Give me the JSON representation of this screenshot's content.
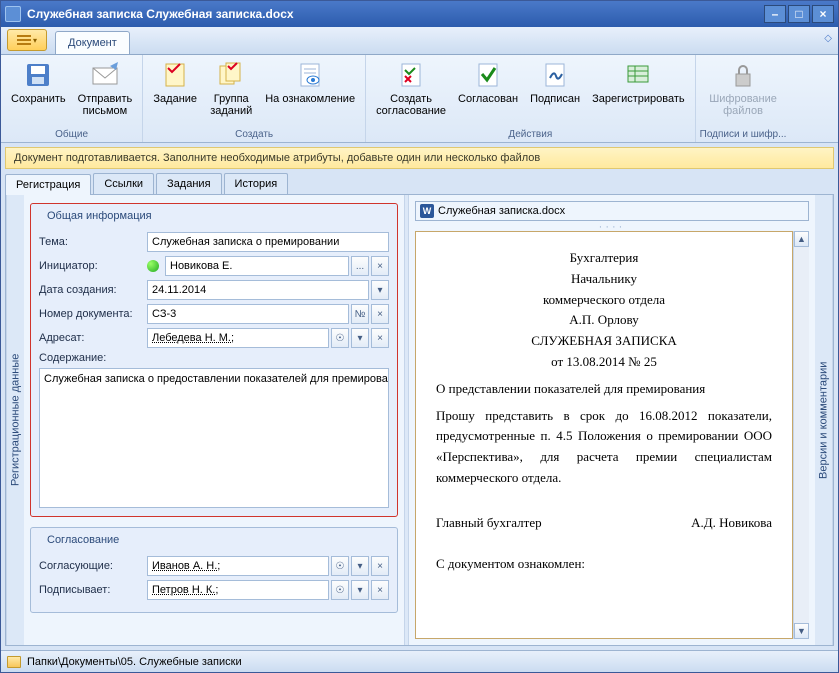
{
  "window": {
    "title": "Служебная записка Служебная записка.docx"
  },
  "menu": {
    "tab_document": "Документ"
  },
  "ribbon": {
    "save": "Сохранить",
    "send_letter": "Отправить\nписьмом",
    "task": "Задание",
    "task_group": "Группа\nзаданий",
    "review": "На ознакомление",
    "create_approval": "Создать\nсогласование",
    "approved": "Согласован",
    "signed": "Подписан",
    "register": "Зарегистрировать",
    "encrypt": "Шифрование\nфайлов",
    "g_common": "Общие",
    "g_create": "Создать",
    "g_actions": "Действия",
    "g_sign": "Подписи и шифр..."
  },
  "infobar": "Документ подготавливается. Заполните необходимые атрибуты, добавьте один или несколько файлов",
  "tabs": {
    "registration": "Регистрация",
    "links": "Ссылки",
    "tasks": "Задания",
    "history": "История"
  },
  "side": {
    "left": "Регистрационные данные",
    "right": "Версии и комментарии"
  },
  "general": {
    "title": "Общая информация",
    "subject_lbl": "Тема:",
    "subject": "Служебная записка о премировании",
    "initiator_lbl": "Инициатор:",
    "initiator": "Новикова Е.",
    "date_lbl": "Дата создания:",
    "date": "24.11.2014",
    "docnum_lbl": "Номер документа:",
    "docnum": "СЗ-3",
    "addressee_lbl": "Адресат:",
    "addressee": "Лебедева Н. М.; ",
    "content_lbl": "Содержание:",
    "content": "Служебная записка о предоставлении показателей для премирования"
  },
  "approval": {
    "title": "Согласование",
    "approvers_lbl": "Согласующие:",
    "approvers": "Иванов А. Н.; ",
    "signer_lbl": "Подписывает:",
    "signer": "Петров Н. К.; "
  },
  "preview": {
    "file_name": "Служебная записка.docx",
    "l1": "Бухгалтерия",
    "l2": "Начальнику",
    "l3": "коммерческого отдела",
    "l4": "А.П. Орлову",
    "l5": "СЛУЖЕБНАЯ ЗАПИСКА",
    "l6": "от 13.08.2014 № 25",
    "l7": "О представлении показателей для премирования",
    "l8": "Прошу представить в срок до 16.08.2012 показатели, предусмотренные п. 4.5 Положения о премировании ООО «Перспектива», для расчета премии специалистам коммерческого отдела.",
    "sig_role": "Главный бухгалтер",
    "sig_name": "А.Д. Новикова",
    "ack": "С документом ознакомлен:"
  },
  "statusbar": {
    "path": "Папки\\Документы\\05. Служебные записки"
  },
  "btn": {
    "ellipsis": "...",
    "clear": "×",
    "dropdown": "▾",
    "num": "№",
    "people": "☉"
  }
}
